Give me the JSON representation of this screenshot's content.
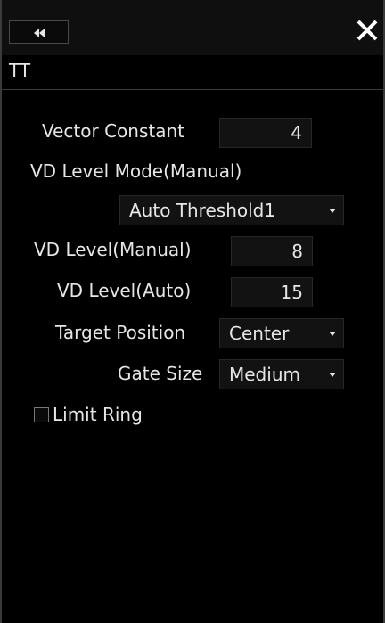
{
  "panel": {
    "title": "TT"
  },
  "icons": {
    "collapse": "double-left-chevron-icon",
    "close": "close-icon"
  },
  "fields": {
    "vector_constant": {
      "label": "Vector Constant",
      "value": "4"
    },
    "vd_level_mode": {
      "label": "VD Level Mode(Manual)",
      "value": "Auto Threshold1"
    },
    "vd_level_manual": {
      "label": "VD Level(Manual)",
      "value": "8"
    },
    "vd_level_auto": {
      "label": "VD Level(Auto)",
      "value": "15"
    },
    "target_position": {
      "label": "Target Position",
      "value": "Center"
    },
    "gate_size": {
      "label": "Gate Size",
      "value": "Medium"
    },
    "limit_ring": {
      "label": "Limit Ring",
      "checked": false
    }
  }
}
